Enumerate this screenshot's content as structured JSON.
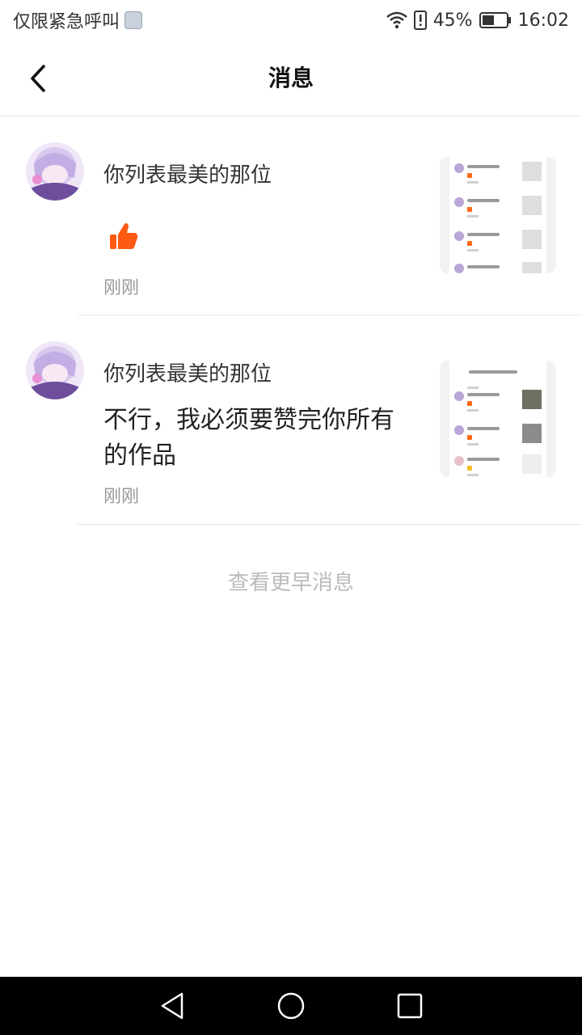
{
  "status_bar": {
    "left_text": "仅限紧急呼叫",
    "battery": "45%",
    "time": "16:02",
    "icons": [
      "shield-icon",
      "wifi-icon",
      "sim-alert-icon",
      "battery-icon"
    ]
  },
  "header": {
    "title": "消息",
    "back_icon": "chevron-left-icon"
  },
  "notifications": [
    {
      "username": "你列表最美的那位",
      "type": "like",
      "like_icon": "thumbs-up-icon",
      "like_color": "#ff5a12",
      "time": "刚刚"
    },
    {
      "username": "你列表最美的那位",
      "type": "comment",
      "message": "不行，我必须要赞完你所有的作品",
      "time": "刚刚"
    }
  ],
  "footer": {
    "more_label": "查看更早消息"
  },
  "nav_bar": {
    "icons": [
      "back-triangle-icon",
      "home-circle-icon",
      "recents-square-icon"
    ]
  },
  "colors": {
    "accent": "#ff5a12",
    "muted_text": "#999999",
    "divider": "#e8e8e8"
  }
}
